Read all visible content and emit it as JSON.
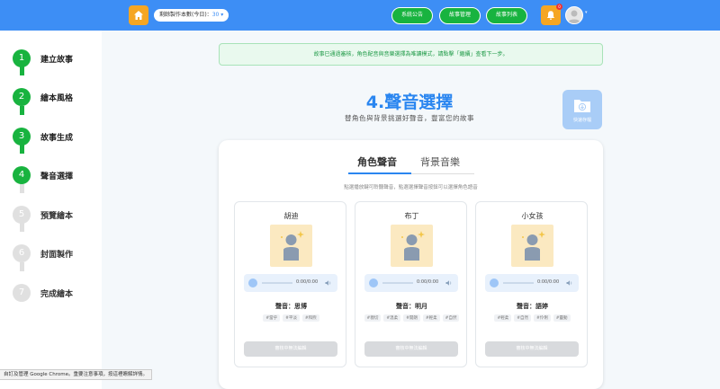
{
  "topbar": {
    "quota_label": "剩餘製作本數(今日)：",
    "quota_value": "30",
    "buttons": [
      "系統公告",
      "故事管理",
      "故事列表"
    ],
    "bell_badge": "0",
    "colors": {
      "bar": "#3d8ef5",
      "home": "#f5a623",
      "pill": "#18b33f"
    }
  },
  "sidebar": {
    "steps": [
      {
        "num": "1",
        "label": "建立故事",
        "state": "done"
      },
      {
        "num": "2",
        "label": "繪本風格",
        "state": "done"
      },
      {
        "num": "3",
        "label": "故事生成",
        "state": "done"
      },
      {
        "num": "4",
        "label": "聲音選擇",
        "state": "done"
      },
      {
        "num": "5",
        "label": "預覽繪本",
        "state": "todo"
      },
      {
        "num": "6",
        "label": "封面製作",
        "state": "todo"
      },
      {
        "num": "7",
        "label": "完成繪本",
        "state": "todo"
      }
    ]
  },
  "main": {
    "notice": "故事已通過審核，角色配音與音樂選擇為唯讀模式，請點擊「繼續」查看下一步。",
    "title": "4.聲音選擇",
    "subtitle": "替角色與背景挑選好聲音，豐富您的故事",
    "save_label": "快速存檔",
    "tabs": [
      "角色聲音",
      "背景音樂"
    ],
    "hint": "點選播放鍵可聆聽聲音，點選選擇聲音按鈕可以選擇角色語音",
    "voices": [
      {
        "name": "胡迪",
        "time": "0:00/0:00",
        "voice_label": "聲音：思博",
        "tags": [
          "#當乎",
          "#平淡",
          "#和煦"
        ],
        "button": "審核中無法編輯"
      },
      {
        "name": "布丁",
        "time": "0:00/0:00",
        "voice_label": "聲音：明月",
        "tags": [
          "#親切",
          "#溫柔",
          "#開朗",
          "#輕柔",
          "#自然"
        ],
        "button": "審核中無法編輯"
      },
      {
        "name": "小女孩",
        "time": "0:00/0:00",
        "voice_label": "聲音：語婷",
        "tags": [
          "#輕柔",
          "#自然",
          "#伶俐",
          "#靈動"
        ],
        "button": "審核中無法編輯"
      }
    ]
  },
  "statusbar": {
    "text": "自訂及管理 Google Chrome。重要注意事項，按這裡瞭解詳情。"
  }
}
